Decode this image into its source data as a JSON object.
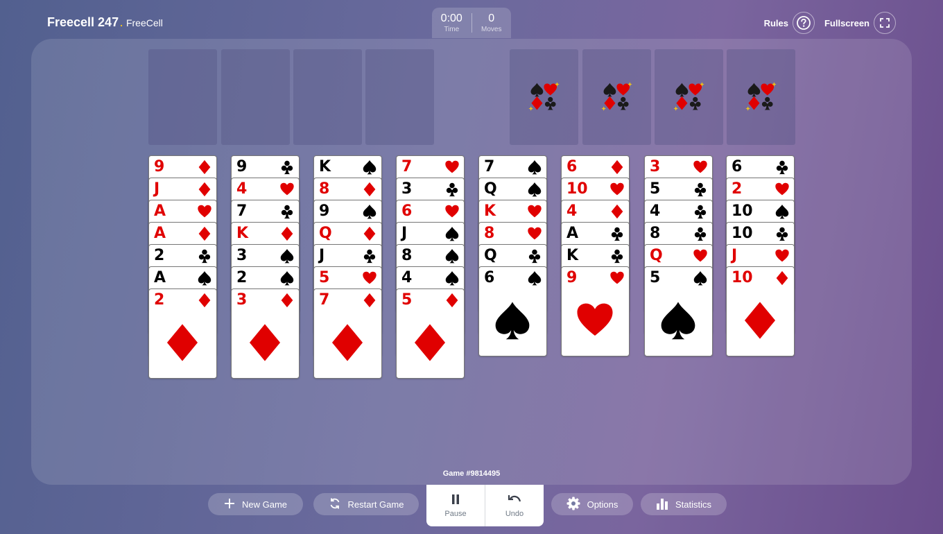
{
  "brand": {
    "name": "Freecell 247",
    "dot": ".",
    "sub": "FreeCell"
  },
  "timer": {
    "time": "0:00",
    "time_label": "Time",
    "moves": "0",
    "moves_label": "Moves"
  },
  "header": {
    "rules_label": "Rules",
    "fullscreen_label": "Fullscreen"
  },
  "free_cells": [
    {
      "state": "empty"
    },
    {
      "state": "empty"
    },
    {
      "state": "empty"
    },
    {
      "state": "empty"
    }
  ],
  "foundations": [
    {
      "state": "empty",
      "icon": "four-suits-icon"
    },
    {
      "state": "empty",
      "icon": "four-suits-icon"
    },
    {
      "state": "empty",
      "icon": "four-suits-icon"
    },
    {
      "state": "empty",
      "icon": "four-suits-icon"
    }
  ],
  "tableau": [
    [
      {
        "rank": "9",
        "suit": "diamond"
      },
      {
        "rank": "J",
        "suit": "diamond"
      },
      {
        "rank": "A",
        "suit": "heart"
      },
      {
        "rank": "A",
        "suit": "diamond"
      },
      {
        "rank": "2",
        "suit": "club"
      },
      {
        "rank": "A",
        "suit": "spade"
      },
      {
        "rank": "2",
        "suit": "diamond"
      }
    ],
    [
      {
        "rank": "9",
        "suit": "club"
      },
      {
        "rank": "4",
        "suit": "heart"
      },
      {
        "rank": "7",
        "suit": "club"
      },
      {
        "rank": "K",
        "suit": "diamond"
      },
      {
        "rank": "3",
        "suit": "spade"
      },
      {
        "rank": "2",
        "suit": "spade"
      },
      {
        "rank": "3",
        "suit": "diamond"
      }
    ],
    [
      {
        "rank": "K",
        "suit": "spade"
      },
      {
        "rank": "8",
        "suit": "diamond"
      },
      {
        "rank": "9",
        "suit": "spade"
      },
      {
        "rank": "Q",
        "suit": "diamond"
      },
      {
        "rank": "J",
        "suit": "club"
      },
      {
        "rank": "5",
        "suit": "heart"
      },
      {
        "rank": "7",
        "suit": "diamond"
      }
    ],
    [
      {
        "rank": "7",
        "suit": "heart"
      },
      {
        "rank": "3",
        "suit": "club"
      },
      {
        "rank": "6",
        "suit": "heart"
      },
      {
        "rank": "J",
        "suit": "spade"
      },
      {
        "rank": "8",
        "suit": "spade"
      },
      {
        "rank": "4",
        "suit": "spade"
      },
      {
        "rank": "5",
        "suit": "diamond"
      }
    ],
    [
      {
        "rank": "7",
        "suit": "spade"
      },
      {
        "rank": "Q",
        "suit": "spade"
      },
      {
        "rank": "K",
        "suit": "heart"
      },
      {
        "rank": "8",
        "suit": "heart"
      },
      {
        "rank": "Q",
        "suit": "club"
      },
      {
        "rank": "6",
        "suit": "spade"
      }
    ],
    [
      {
        "rank": "6",
        "suit": "diamond"
      },
      {
        "rank": "10",
        "suit": "heart"
      },
      {
        "rank": "4",
        "suit": "diamond"
      },
      {
        "rank": "A",
        "suit": "club"
      },
      {
        "rank": "K",
        "suit": "club"
      },
      {
        "rank": "9",
        "suit": "heart"
      }
    ],
    [
      {
        "rank": "3",
        "suit": "heart"
      },
      {
        "rank": "5",
        "suit": "club"
      },
      {
        "rank": "4",
        "suit": "club"
      },
      {
        "rank": "8",
        "suit": "club"
      },
      {
        "rank": "Q",
        "suit": "heart"
      },
      {
        "rank": "5",
        "suit": "spade"
      }
    ],
    [
      {
        "rank": "6",
        "suit": "club"
      },
      {
        "rank": "2",
        "suit": "heart"
      },
      {
        "rank": "10",
        "suit": "spade"
      },
      {
        "rank": "10",
        "suit": "club"
      },
      {
        "rank": "J",
        "suit": "heart"
      },
      {
        "rank": "10",
        "suit": "diamond"
      }
    ]
  ],
  "colors": {
    "red": "#e00000",
    "black": "#000000",
    "sparkle": "#f0c419"
  },
  "game": {
    "number_text": "Game #9814495"
  },
  "footer": {
    "new_game_label": "New Game",
    "new_game_icon": "plus-icon",
    "restart_label": "Restart Game",
    "restart_icon": "restart-icon",
    "pause_label": "Pause",
    "pause_icon": "pause-icon",
    "undo_label": "Undo",
    "undo_icon": "undo-icon",
    "options_label": "Options",
    "options_icon": "gear-icon",
    "statistics_label": "Statistics",
    "statistics_icon": "bar-chart-icon"
  }
}
